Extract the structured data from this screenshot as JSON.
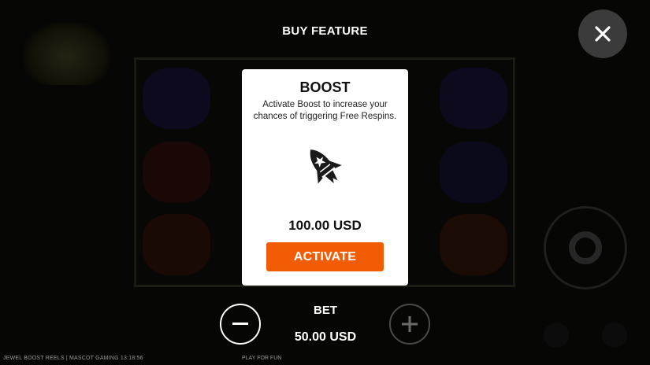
{
  "header": {
    "title": "BUY FEATURE"
  },
  "icons": {
    "close": "close-icon",
    "rocket": "rocket-icon",
    "minus": "minus-icon",
    "plus": "plus-icon"
  },
  "feature_card": {
    "name": "BOOST",
    "description": "Activate Boost to increase your chances of triggering Free Respins.",
    "price": "100.00 USD",
    "activate_label": "ACTIVATE"
  },
  "bet": {
    "label": "BET",
    "value": "50.00 USD"
  },
  "footer": {
    "game_info": "JEWEL BOOST REELS | MASCOT GAMING  13:18:56",
    "mode": "PLAY FOR FUN"
  },
  "colors": {
    "accent": "#f25c05",
    "card": "#ffffff",
    "backdrop": "#000000",
    "close_button": "#3b3b3b"
  }
}
